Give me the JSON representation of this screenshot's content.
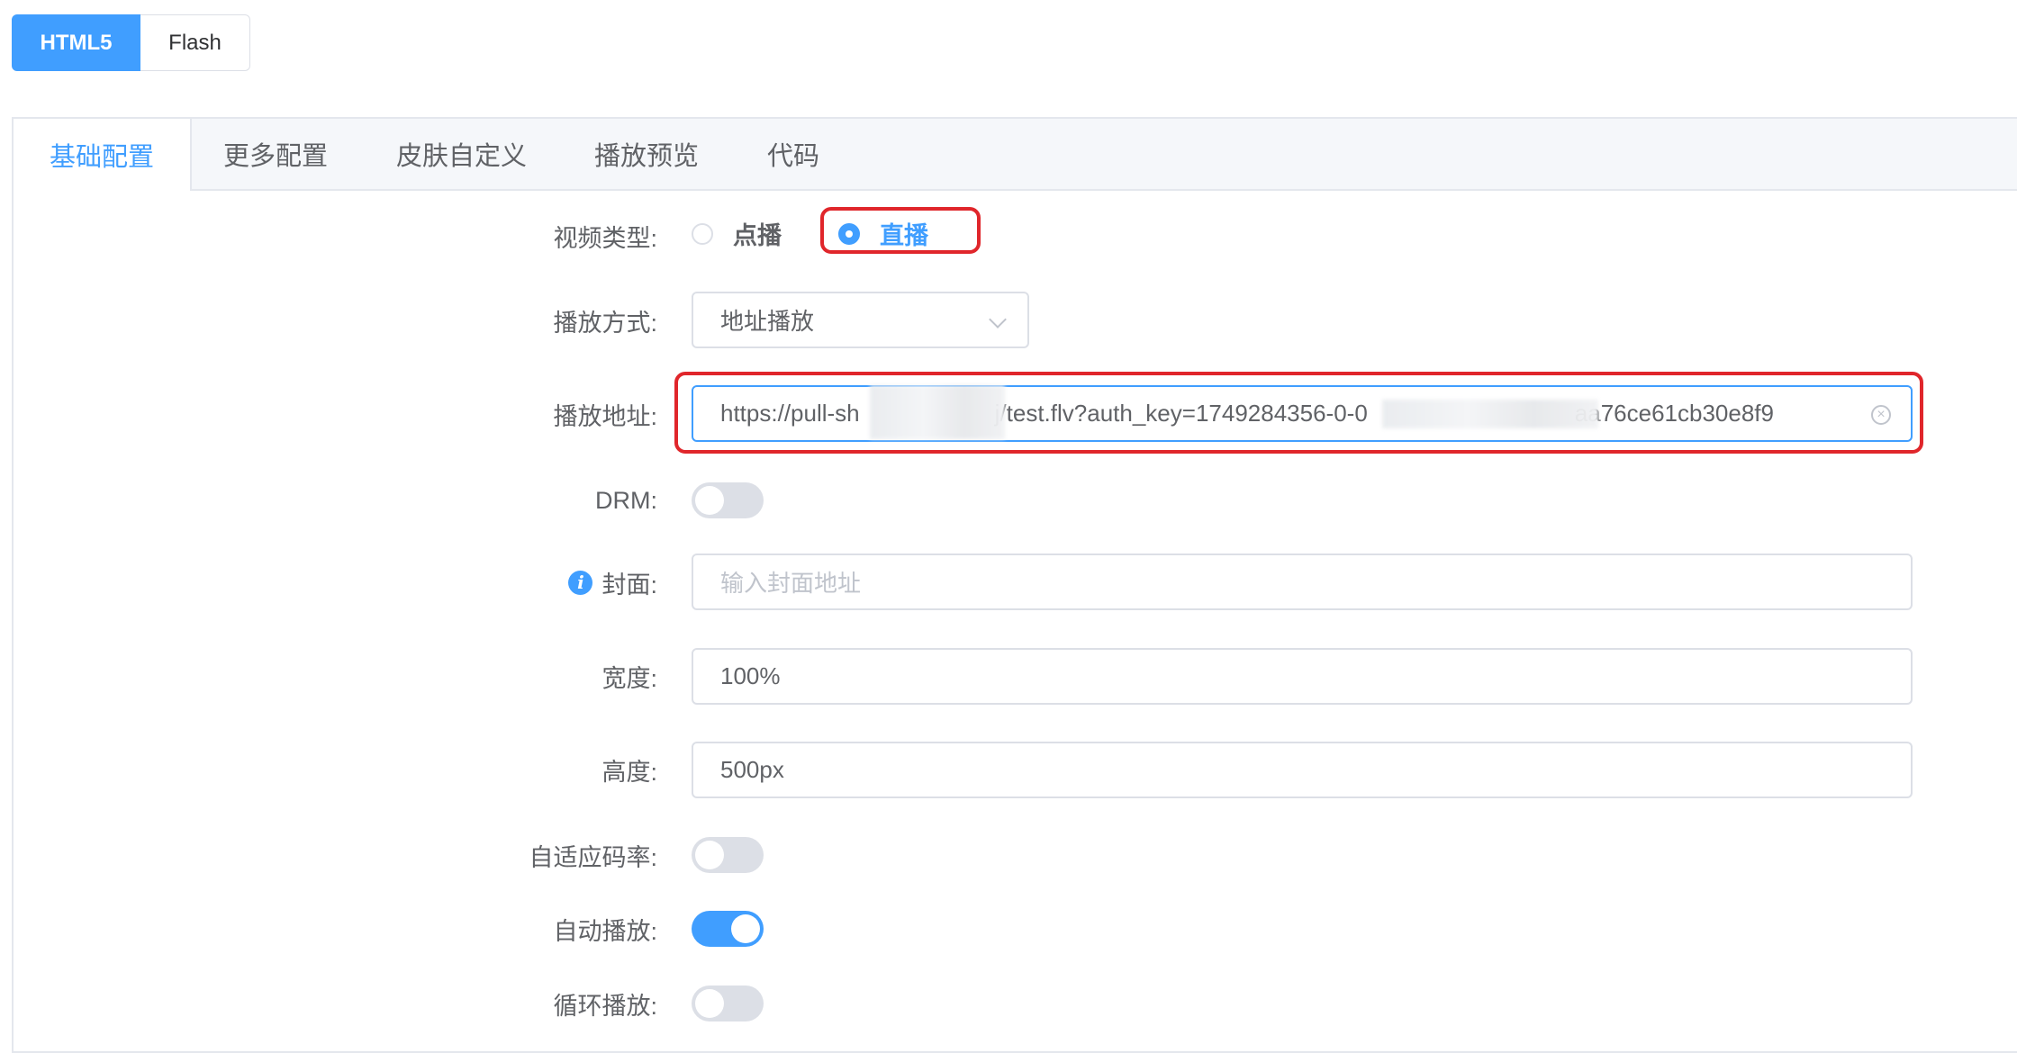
{
  "segmented": {
    "html5": "HTML5",
    "flash": "Flash"
  },
  "tabs": [
    {
      "label": "基础配置",
      "active": true
    },
    {
      "label": "更多配置",
      "active": false
    },
    {
      "label": "皮肤自定义",
      "active": false
    },
    {
      "label": "播放预览",
      "active": false
    },
    {
      "label": "代码",
      "active": false
    }
  ],
  "form": {
    "video_type": {
      "label": "视频类型:",
      "options": [
        "点播",
        "直播"
      ],
      "selected": "直播"
    },
    "play_mode": {
      "label": "播放方式:",
      "value": "地址播放"
    },
    "play_url": {
      "label": "播放地址:",
      "value_part1": "https://pull-sh",
      "value_part2": "j/test.flv?auth_key=1749284356-0-0",
      "value_part3": "aa76ce61cb30e8f9"
    },
    "drm": {
      "label": "DRM:",
      "on": false
    },
    "cover": {
      "label": "封面:",
      "placeholder": "输入封面地址",
      "value": ""
    },
    "width": {
      "label": "宽度:",
      "value": "100%"
    },
    "height": {
      "label": "高度:",
      "value": "500px"
    },
    "adaptive_bitrate": {
      "label": "自适应码率:",
      "on": false
    },
    "autoplay": {
      "label": "自动播放:",
      "on": true
    },
    "loop": {
      "label": "循环播放:",
      "on": false
    }
  },
  "colors": {
    "accent": "#409eff",
    "highlight_box": "#e0262b"
  }
}
